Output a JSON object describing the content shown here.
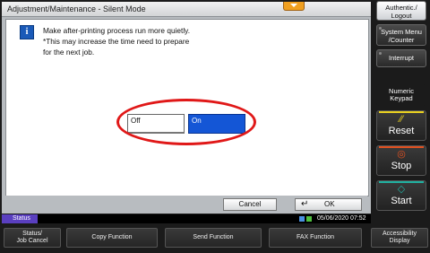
{
  "screen": {
    "title": "Adjustment/Maintenance - Silent Mode",
    "message_lines": [
      "Make after-printing process run more quietly.",
      "*This may increase the time need to prepare",
      "for the next job."
    ],
    "options": {
      "off": "Off",
      "on": "On",
      "selected": "On"
    },
    "cancel_label": "Cancel",
    "ok_label": "OK",
    "ok_icon": "↵",
    "info_icon": "i"
  },
  "status_bar": {
    "label": "Status",
    "datetime": "05/06/2020  07:52"
  },
  "function_keys": {
    "status_job_cancel": [
      "Status/",
      "Job Cancel"
    ],
    "copy": "Copy Function",
    "send": "Send Function",
    "fax": "FAX Function",
    "accessibility": [
      "Accessibility",
      "Display"
    ]
  },
  "side_panel": {
    "authentic": [
      "Authentic./",
      "Logout"
    ],
    "system_menu": [
      "System Menu",
      "/Counter"
    ],
    "interrupt": "Interrupt",
    "numeric_keypad": [
      "Numeric",
      "Keypad"
    ],
    "reset": "Reset",
    "stop": "Stop",
    "start": "Start"
  },
  "colors": {
    "selected_option": "#1456d6",
    "highlight_ring": "#e01818",
    "status_label": "#5a3fc0",
    "reset_accent": "#e8d020",
    "stop_accent": "#e05020",
    "start_accent": "#20b0a0"
  }
}
